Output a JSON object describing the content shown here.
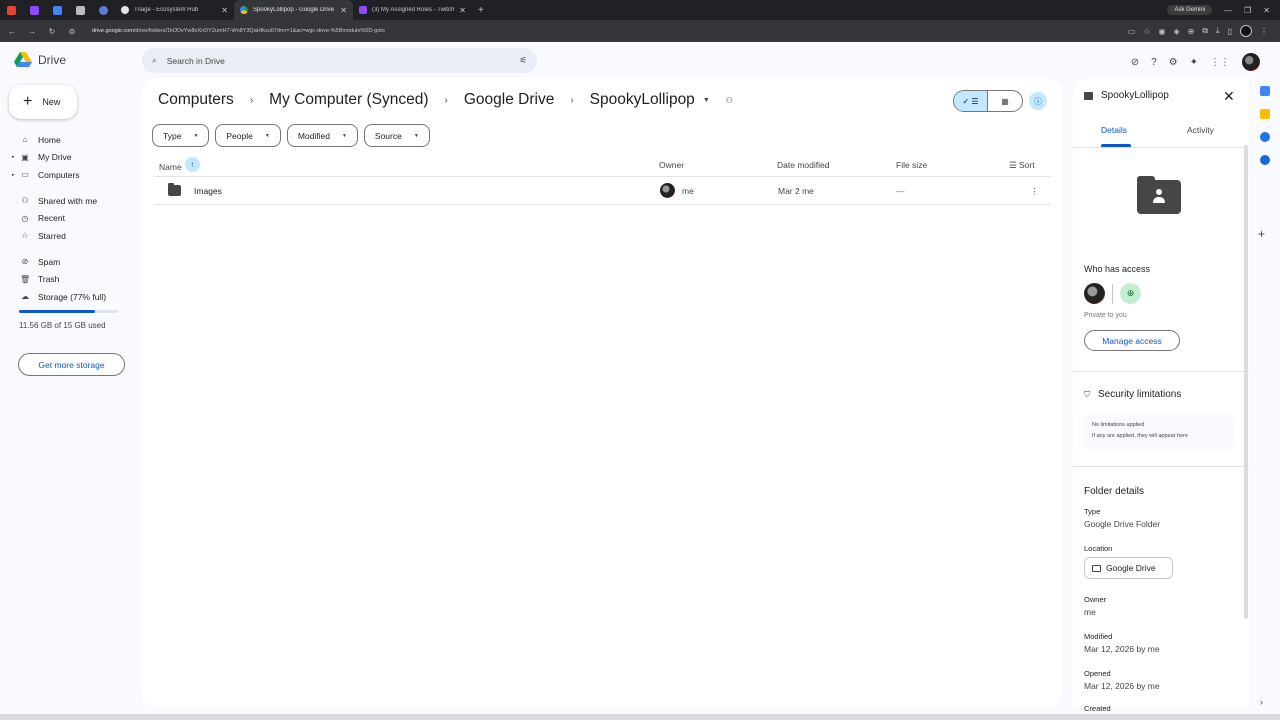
{
  "browser": {
    "tabs": [
      {
        "title": "Triage - Ecosystem Hub",
        "active": false
      },
      {
        "title": "SpookyLollipop - Google Drive",
        "active": true
      },
      {
        "title": "(3) My Assigned Roles - Twitch",
        "active": false
      }
    ],
    "ask_gemini": "Ask Gemini",
    "url_host": "drive.google.com",
    "url_path": "/drive/folders/1kODvYw8oXnDY2umH7-Wn8Y3QaHfksu07dmr=1&ac=wgc-drive-%5Bmodule%5D-goto"
  },
  "app": {
    "name": "Drive",
    "search_placeholder": "Search in Drive"
  },
  "nav": {
    "new_label": "New",
    "items": [
      {
        "label": "Home",
        "icon": "home-icon"
      },
      {
        "label": "My Drive",
        "icon": "my-drive-icon"
      },
      {
        "label": "Computers",
        "icon": "computer-icon"
      },
      {
        "label": "Shared with me",
        "icon": "shared-icon"
      },
      {
        "label": "Recent",
        "icon": "clock-icon"
      },
      {
        "label": "Starred",
        "icon": "star-icon"
      },
      {
        "label": "Spam",
        "icon": "spam-icon"
      },
      {
        "label": "Trash",
        "icon": "trash-icon"
      },
      {
        "label": "Storage (77% full)",
        "icon": "cloud-icon"
      }
    ],
    "storage_used_text": "11.56 GB of 15 GB used",
    "storage_fraction": 0.77,
    "get_more_storage": "Get more storage"
  },
  "breadcrumb": [
    "Computers",
    "My Computer (Synced)",
    "Google Drive",
    "SpookyLollipop"
  ],
  "filters": [
    "Type",
    "People",
    "Modified",
    "Source"
  ],
  "table": {
    "columns": {
      "name": "Name",
      "owner": "Owner",
      "date_modified": "Date modified",
      "file_size": "File size",
      "sort": "Sort"
    },
    "rows": [
      {
        "name": "Images",
        "owner": "me",
        "date_modified": "Mar 2 me",
        "file_size": "—"
      }
    ]
  },
  "details": {
    "title": "SpookyLollipop",
    "tabs": [
      "Details",
      "Activity"
    ],
    "who_has_access": "Who has access",
    "private_text": "Private to you",
    "manage_access": "Manage access",
    "security_title": "Security limitations",
    "security_line1": "No limitations applied",
    "security_line2": "If any are applied, they will appear here",
    "folder_details": "Folder details",
    "type_label": "Type",
    "type_value": "Google Drive Folder",
    "location_label": "Location",
    "location_value": "Google Drive",
    "owner_label": "Owner",
    "owner_value": "me",
    "modified_label": "Modified",
    "modified_value": "Mar 12, 2026 by me",
    "opened_label": "Opened",
    "opened_value": "Mar 12, 2026 by me",
    "created_label": "Created"
  },
  "colors": {
    "accent": "#0b57d0",
    "selected": "#c2e7ff"
  }
}
